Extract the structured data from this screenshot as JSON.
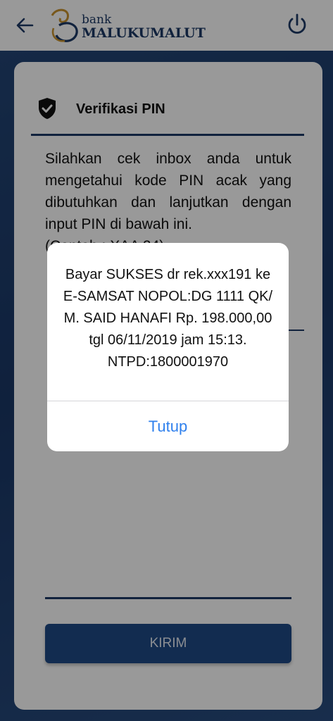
{
  "header": {
    "brand_small": "bank",
    "brand_name": "MALUKUMALUT",
    "back_icon": "arrow-left-icon",
    "power_icon": "power-icon"
  },
  "card": {
    "title": "Verifikasi PIN",
    "title_icon": "shield-check-icon",
    "instruction": "Silahkan cek inbox anda untuk mengetahui kode PIN acak yang dibutuhkan dan lanjutkan dengan input PIN di bawah ini.",
    "example": "(Contoh : XAA 24)",
    "submit_label": "KIRIM"
  },
  "dialog": {
    "message": "Bayar SUKSES dr rek.xxx191 ke E-SAMSAT NOPOL:DG 1111 QK/ M. SAID HANAFI Rp. 198.000,00 tgl 06/11/2019 jam 15:13. NTPD:1800001970",
    "button_label": "Tutup"
  },
  "colors": {
    "primary": "#1d3a66",
    "button": "#1f4a86",
    "link": "#2f80ed",
    "logo_gold": "#c8932f"
  }
}
